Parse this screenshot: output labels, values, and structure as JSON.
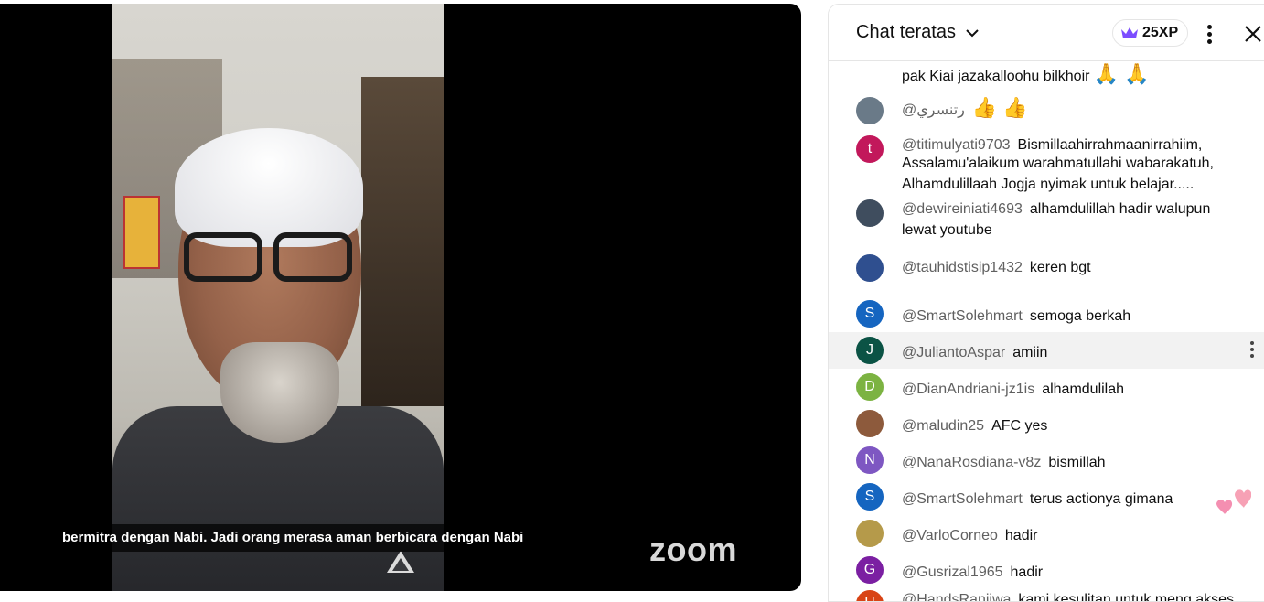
{
  "video": {
    "subtitle": "bermitra dengan Nabi. Jadi orang merasa aman berbicara dengan Nabi",
    "watermark": "zoom"
  },
  "chat": {
    "title": "Chat teratas",
    "xp_badge": "25XP",
    "partial_top_message": "pak Kiai jazakalloohu bilkhoir",
    "partial_top_emoji": "🙏 🙏",
    "messages": [
      {
        "author": "@رتنسري",
        "text": "",
        "emoji": "👍 👍",
        "avatar_letter": "",
        "avatar_color": "#6a7a88"
      },
      {
        "author": "@titimulyati9703",
        "text": "Bismillaahirrahmaanirrahiim, Assalamu'alaikum warahmatullahi wabarakatuh, Alhamdulillaah Jogja nyimak untuk belajar.....",
        "emoji": "",
        "avatar_letter": "t",
        "avatar_color": "#c2185b"
      },
      {
        "author": "@dewireiniati4693",
        "text": "alhamdulillah hadir walupun lewat youtube",
        "emoji": "",
        "avatar_letter": "",
        "avatar_color": "#3f4d5e"
      },
      {
        "author": "@tauhidstisip1432",
        "text": "keren bgt",
        "emoji": "",
        "avatar_letter": "",
        "avatar_color": "#2f4f8f"
      },
      {
        "author": "@SmartSolehmart",
        "text": "semoga berkah",
        "emoji": "",
        "avatar_letter": "S",
        "avatar_color": "#1565c0"
      },
      {
        "author": "@JuliantoAspar",
        "text": "amiin",
        "emoji": "",
        "avatar_letter": "J",
        "avatar_color": "#0b5345"
      },
      {
        "author": "@DianAndriani-jz1is",
        "text": "alhamdulilah",
        "emoji": "",
        "avatar_letter": "D",
        "avatar_color": "#7cb342"
      },
      {
        "author": "@maludin25",
        "text": "AFC yes",
        "emoji": "",
        "avatar_letter": "",
        "avatar_color": "#8d5a3c"
      },
      {
        "author": "@NanaRosdiana-v8z",
        "text": "bismillah",
        "emoji": "",
        "avatar_letter": "N",
        "avatar_color": "#7e57c2"
      },
      {
        "author": "@SmartSolehmart",
        "text": "terus actionya gimana",
        "emoji": "",
        "avatar_letter": "S",
        "avatar_color": "#1565c0"
      },
      {
        "author": "@VarloCorneo",
        "text": "hadir",
        "emoji": "",
        "avatar_letter": "",
        "avatar_color": "#b59a4a"
      },
      {
        "author": "@Gusrizal1965",
        "text": "hadir",
        "emoji": "",
        "avatar_letter": "G",
        "avatar_color": "#7b1fa2"
      },
      {
        "author": "@HandsRanjiwa",
        "text": "kami kesulitan untuk meng akses mohon bantuan",
        "emoji": "",
        "avatar_letter": "H",
        "avatar_color": "#d84315"
      }
    ]
  },
  "colors": {
    "author_gray": "#606060",
    "crown_purple": "#7c4dff",
    "highlight_row": "#f2f2f2"
  },
  "icons": [
    "chevron-down-icon",
    "crown-icon",
    "more-vert-icon",
    "close-icon",
    "hearts-icon"
  ]
}
